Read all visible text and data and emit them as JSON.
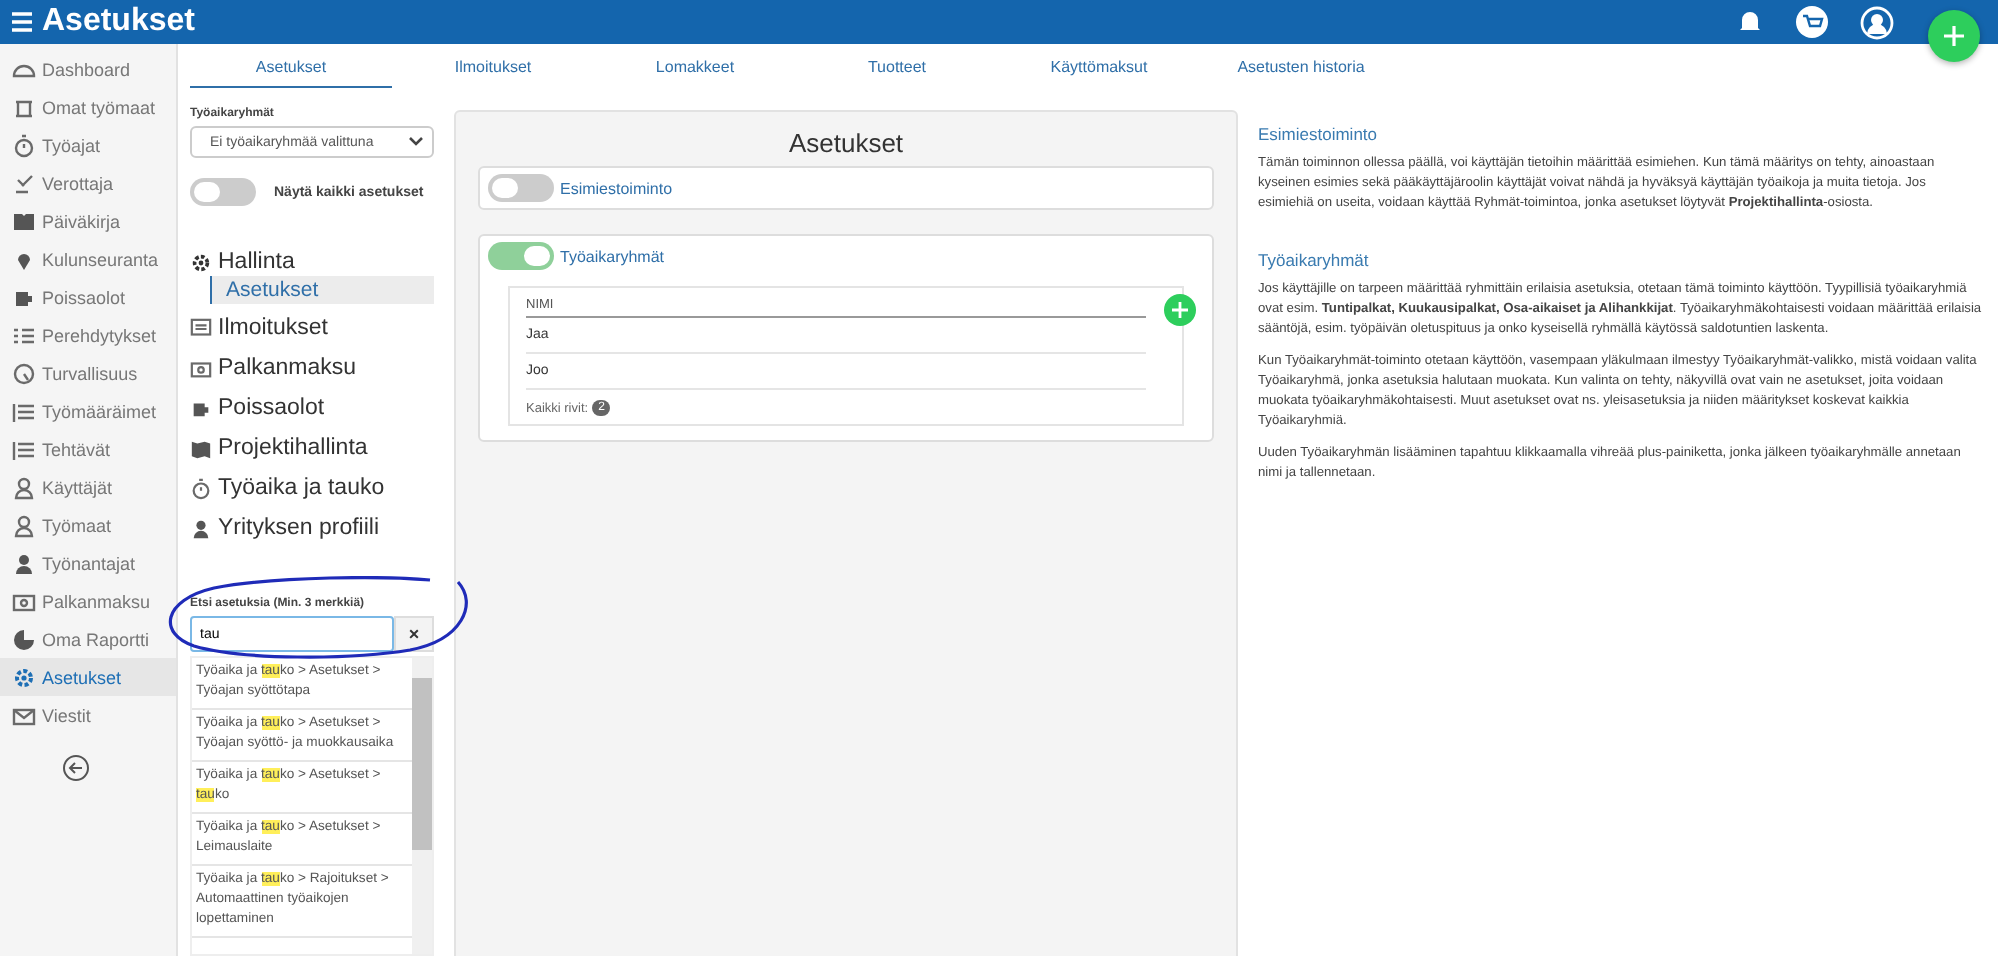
{
  "header": {
    "title": "Asetukset"
  },
  "sidebar": {
    "items": [
      {
        "label": "Dashboard",
        "selected": false
      },
      {
        "label": "Omat työmaat",
        "selected": false
      },
      {
        "label": "Työajat",
        "selected": false
      },
      {
        "label": "Verottaja",
        "selected": false
      },
      {
        "label": "Päiväkirja",
        "selected": false
      },
      {
        "label": "Kulunseuranta",
        "selected": false
      },
      {
        "label": "Poissaolot",
        "selected": false
      },
      {
        "label": "Perehdytykset",
        "selected": false
      },
      {
        "label": "Turvallisuus",
        "selected": false
      },
      {
        "label": "Työmääräimet",
        "selected": false
      },
      {
        "label": "Tehtävät",
        "selected": false
      },
      {
        "label": "Käyttäjät",
        "selected": false
      },
      {
        "label": "Työmaat",
        "selected": false
      },
      {
        "label": "Työnantajat",
        "selected": false
      },
      {
        "label": "Palkanmaksu",
        "selected": false
      },
      {
        "label": "Oma Raportti",
        "selected": false
      },
      {
        "label": "Asetukset",
        "selected": true
      },
      {
        "label": "Viestit",
        "selected": false
      }
    ]
  },
  "tabs": [
    {
      "label": "Asetukset",
      "selected": true
    },
    {
      "label": "Ilmoitukset",
      "selected": false
    },
    {
      "label": "Lomakkeet",
      "selected": false
    },
    {
      "label": "Tuotteet",
      "selected": false
    },
    {
      "label": "Käyttömaksut",
      "selected": false
    },
    {
      "label": "Asetusten historia",
      "selected": false
    }
  ],
  "settings_panel": {
    "group_select": {
      "label": "Työaikaryhmät",
      "value": "Ei työaikaryhmää valittuna"
    },
    "show_all": {
      "label": "Näytä kaikki asetukset",
      "on": false
    },
    "nav": [
      {
        "label": "Hallinta",
        "children": [
          {
            "label": "Asetukset",
            "selected": true
          }
        ]
      },
      {
        "label": "Ilmoitukset"
      },
      {
        "label": "Palkanmaksu"
      },
      {
        "label": "Poissaolot"
      },
      {
        "label": "Projektihallinta"
      },
      {
        "label": "Työaika ja tauko"
      },
      {
        "label": "Yrityksen profiili"
      }
    ],
    "search": {
      "label": "Etsi asetuksia (Min. 3 merkkiä)",
      "value": "tau",
      "clear": "×",
      "results": [
        {
          "parts": [
            {
              "text": "Työaika ja ",
              "highlight": false
            },
            {
              "text": "tau",
              "highlight": true
            },
            {
              "text": "ko > Asetukset > Työajan syöttötapa",
              "highlight": false
            }
          ]
        },
        {
          "parts": [
            {
              "text": "Työaika ja ",
              "highlight": false
            },
            {
              "text": "tau",
              "highlight": true
            },
            {
              "text": "ko > Asetukset > Työajan syöttö- ja muokkausaika",
              "highlight": false
            }
          ]
        },
        {
          "parts": [
            {
              "text": "Työaika ja ",
              "highlight": false
            },
            {
              "text": "tau",
              "highlight": true
            },
            {
              "text": "ko > Asetukset > ",
              "highlight": false
            },
            {
              "text": "tau",
              "highlight": true
            },
            {
              "text": "ko",
              "highlight": false
            }
          ]
        },
        {
          "parts": [
            {
              "text": "Työaika ja ",
              "highlight": false
            },
            {
              "text": "tau",
              "highlight": true
            },
            {
              "text": "ko > Asetukset > Leimauslaite",
              "highlight": false
            }
          ]
        },
        {
          "parts": [
            {
              "text": "Työaika ja ",
              "highlight": false
            },
            {
              "text": "tau",
              "highlight": true
            },
            {
              "text": "ko > Rajoitukset > Automaattinen työaikojen lopettaminen",
              "highlight": false
            }
          ]
        }
      ]
    }
  },
  "main": {
    "title": "Asetukset",
    "sections": [
      {
        "title": "Esimiestoiminto",
        "on": false
      },
      {
        "title": "Työaikaryhmät",
        "on": true,
        "table": {
          "columns": [
            "NIMI"
          ],
          "rows": [
            "Jaa",
            "Joo"
          ],
          "total_label": "Kaikki rivit:",
          "total": "2"
        }
      }
    ]
  },
  "help": [
    {
      "title": "Esimiestoiminto",
      "paragraphs": [
        "Tämän toiminnon ollessa päällä, voi käyttäjän tietoihin määrittää esimiehen. Kun tämä määritys on tehty, ainoastaan kyseinen esimies sekä pääkäyttäjäroolin käyttäjät voivat nähdä ja hyväksyä käyttäjän työaikoja ja muita tietoja. Jos esimiehiä on useita, voidaan käyttää Ryhmät-toimintoa, jonka asetukset löytyvät **Projektihallinta**-osiosta."
      ]
    },
    {
      "title": "Työaikaryhmät",
      "paragraphs": [
        "Jos käyttäjille on tarpeen määrittää ryhmittäin erilaisia asetuksia, otetaan tämä toiminto käyttöön. Tyypillisiä työaikaryhmiä ovat esim. **Tuntipalkat, Kuukausipalkat, Osa-aikaiset ja Alihankkijat**. Työaikaryhmäkohtaisesti voidaan määrittää erilaisia sääntöjä, esim. työpäivän oletuspituus ja onko kyseisellä ryhmällä käytössä saldotuntien laskenta.",
        "Kun Työaikaryhmät-toiminto otetaan käyttöön, vasempaan yläkulmaan ilmestyy Työaikaryhmät-valikko, mistä voidaan valita Työaikaryhmä, jonka asetuksia halutaan muokata. Kun valinta on tehty, näkyvillä ovat vain ne asetukset, joita voidaan muokata työaikaryhmäkohtaisesti. Muut asetukset ovat ns. yleisasetuksia ja niiden määritykset koskevat kaikkia Työaikaryhmiä.",
        "Uuden Työaikaryhmän lisääminen tapahtuu klikkaamalla vihreää plus-painiketta, jonka jälkeen työaikaryhmälle annetaan nimi ja tallennetaan."
      ]
    }
  ]
}
